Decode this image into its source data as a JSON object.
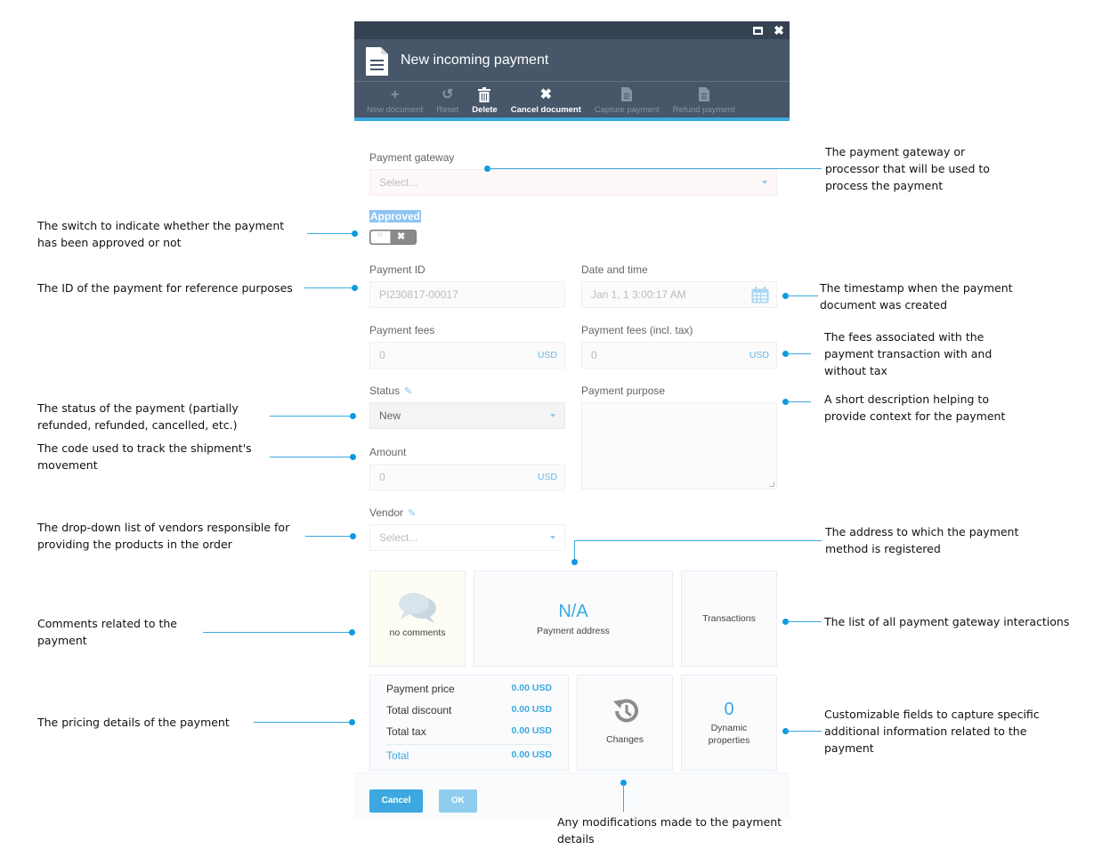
{
  "window": {
    "title": "New incoming payment",
    "maximize_icon": "maximize-icon",
    "close_icon": "close-icon"
  },
  "toolbar": {
    "items": [
      {
        "label": "New document",
        "icon": "plus-icon",
        "glyph": "+",
        "enabled": false
      },
      {
        "label": "Reset",
        "icon": "reset-icon",
        "glyph": "↺",
        "enabled": false
      },
      {
        "label": "Delete",
        "icon": "trash-icon",
        "glyph": "🗑",
        "enabled": true
      },
      {
        "label": "Cancel document",
        "icon": "x-icon",
        "glyph": "✖",
        "enabled": true
      },
      {
        "label": "Capture payment",
        "icon": "document-icon",
        "glyph": "▤",
        "enabled": false
      },
      {
        "label": "Refund payment",
        "icon": "document-icon",
        "glyph": "▤",
        "enabled": false
      }
    ]
  },
  "form": {
    "payment_gateway": {
      "label": "Payment gateway",
      "placeholder": "Select..."
    },
    "approved": {
      "label": "Approved",
      "value": false
    },
    "payment_id": {
      "label": "Payment ID",
      "value": "PI230817-00017"
    },
    "date_time": {
      "label": "Date and time",
      "value": "Jan 1, 1 3:00:17 AM"
    },
    "payment_fees": {
      "label": "Payment fees",
      "value": "0",
      "currency": "USD"
    },
    "payment_fees_tax": {
      "label": "Payment fees (incl. tax)",
      "value": "0",
      "currency": "USD"
    },
    "status": {
      "label": "Status",
      "value": "New"
    },
    "payment_purpose": {
      "label": "Payment purpose",
      "value": ""
    },
    "amount": {
      "label": "Amount",
      "value": "0",
      "currency": "USD"
    },
    "vendor": {
      "label": "Vendor",
      "placeholder": "Select..."
    }
  },
  "tiles": {
    "comments": {
      "caption": "no comments"
    },
    "address": {
      "value": "N/A",
      "caption": "Payment address"
    },
    "transactions": {
      "caption": "Transactions"
    },
    "changes": {
      "caption": "Changes"
    },
    "dynamic": {
      "value": "0",
      "caption_line1": "Dynamic",
      "caption_line2": "properties"
    }
  },
  "pricing": {
    "rows": [
      {
        "label": "Payment price",
        "value": "0.00 USD"
      },
      {
        "label": "Total discount",
        "value": "0.00 USD"
      },
      {
        "label": "Total tax",
        "value": "0.00 USD"
      }
    ],
    "total": {
      "label": "Total",
      "value": "0.00 USD"
    }
  },
  "footer": {
    "cancel_label": "Cancel",
    "ok_label": "OK"
  },
  "annotations": {
    "gateway": [
      "The payment gateway or",
      "processor that will be used to",
      "process the payment"
    ],
    "approved": [
      "The switch to indicate whether the payment",
      "has been approved or not"
    ],
    "payment_id": [
      "The ID of the payment for reference purposes"
    ],
    "timestamp": [
      "The timestamp when the payment",
      "document was created"
    ],
    "fees": [
      "The fees associated with the",
      "payment transaction with and",
      "without tax"
    ],
    "status": [
      "The status of the payment (partially",
      "refunded, refunded, cancelled, etc.)"
    ],
    "purpose": [
      "A short description helping to",
      "provide context for the payment"
    ],
    "tracking": [
      "The code used to track the shipment's",
      "movement"
    ],
    "vendor": [
      "The drop-down list of vendors responsible for",
      "providing the products in the order"
    ],
    "address": [
      "The address to which the payment",
      "method is registered"
    ],
    "comments": [
      "Comments related to the",
      "payment"
    ],
    "transactions": [
      "The list of all payment gateway interactions"
    ],
    "pricing": [
      "The pricing details of the payment"
    ],
    "dynamic": [
      "Customizable fields to capture specific",
      "additional information related to the",
      "payment"
    ],
    "changes": [
      "Any modifications made to the payment",
      "details"
    ]
  },
  "colors": {
    "accent": "#3aa9e0",
    "header_bg": "#475669",
    "titlebar_bg": "#354252"
  }
}
